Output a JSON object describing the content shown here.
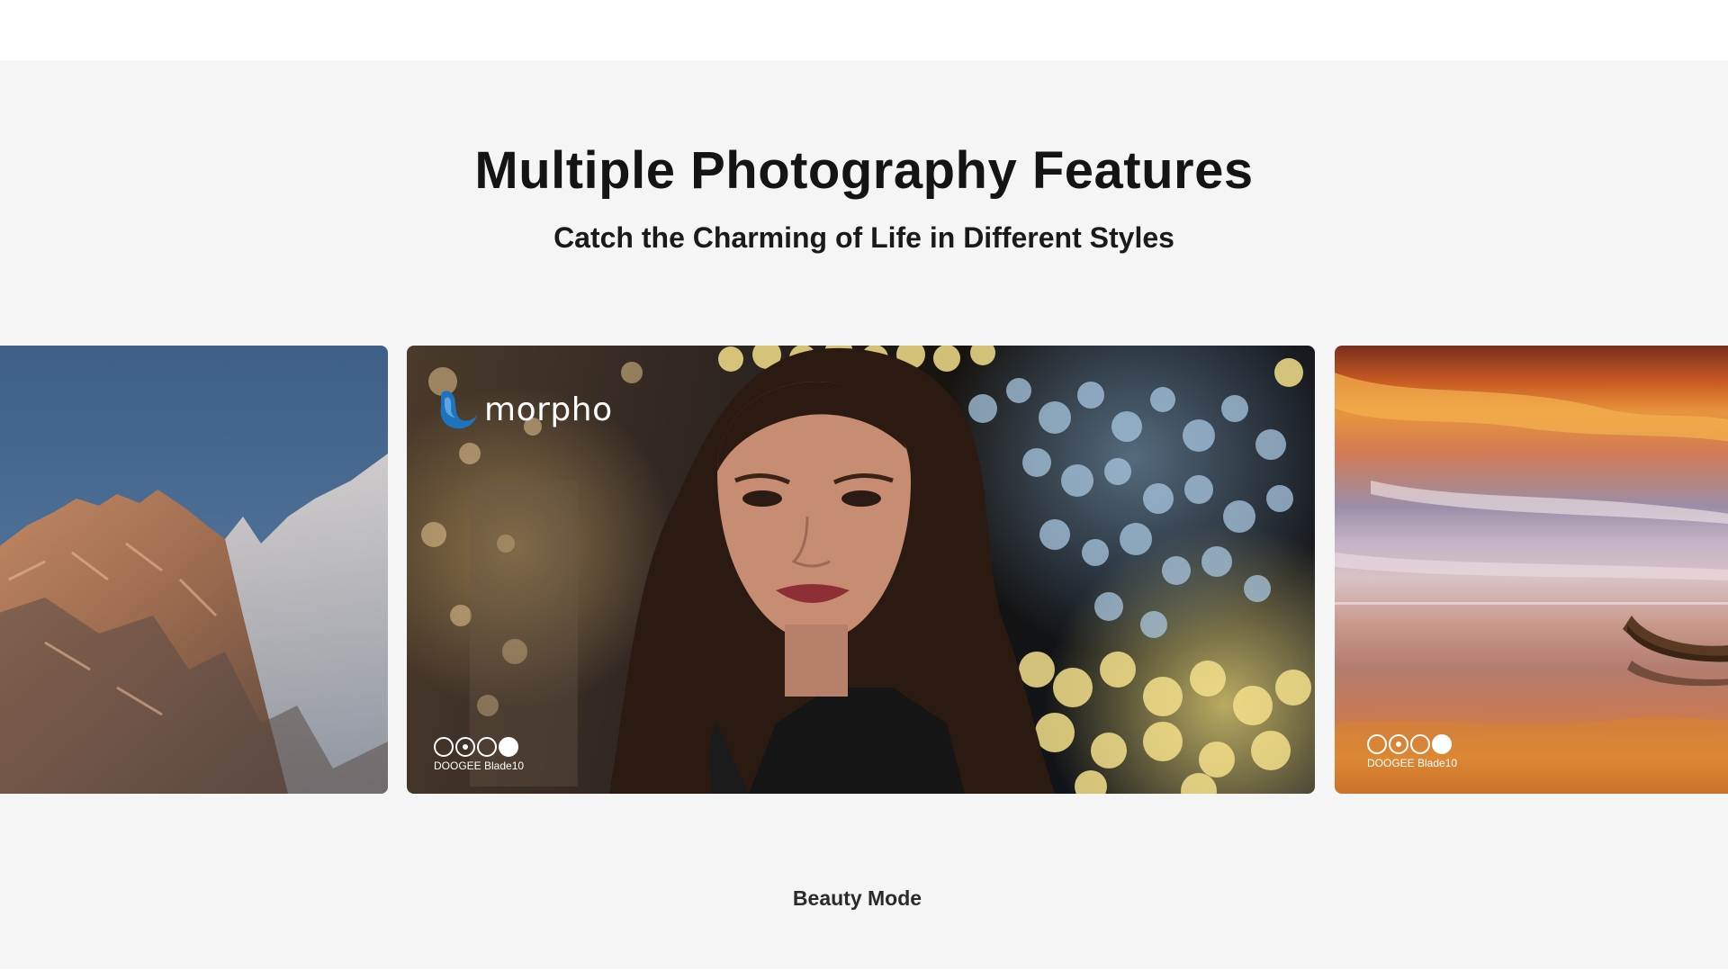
{
  "section": {
    "title": "Multiple Photography Features",
    "subtitle": "Catch the Charming of Life in Different Styles"
  },
  "carousel": {
    "current_caption": "Beauty Mode",
    "slides": [
      {
        "scene": "mountain"
      },
      {
        "scene": "portrait",
        "brand_logo": "morpho",
        "camera_label": "DOOGEE Blade10"
      },
      {
        "scene": "sunset-boat",
        "camera_label": "DOOGEE Blade10"
      }
    ]
  },
  "icons": {
    "brand_mark": "morpho-butterfly-icon",
    "camera_badge": "quad-camera-icon"
  },
  "colors": {
    "section_background": "#f5f5f5",
    "title": "#141414",
    "brand_mark": "#1e73be"
  }
}
